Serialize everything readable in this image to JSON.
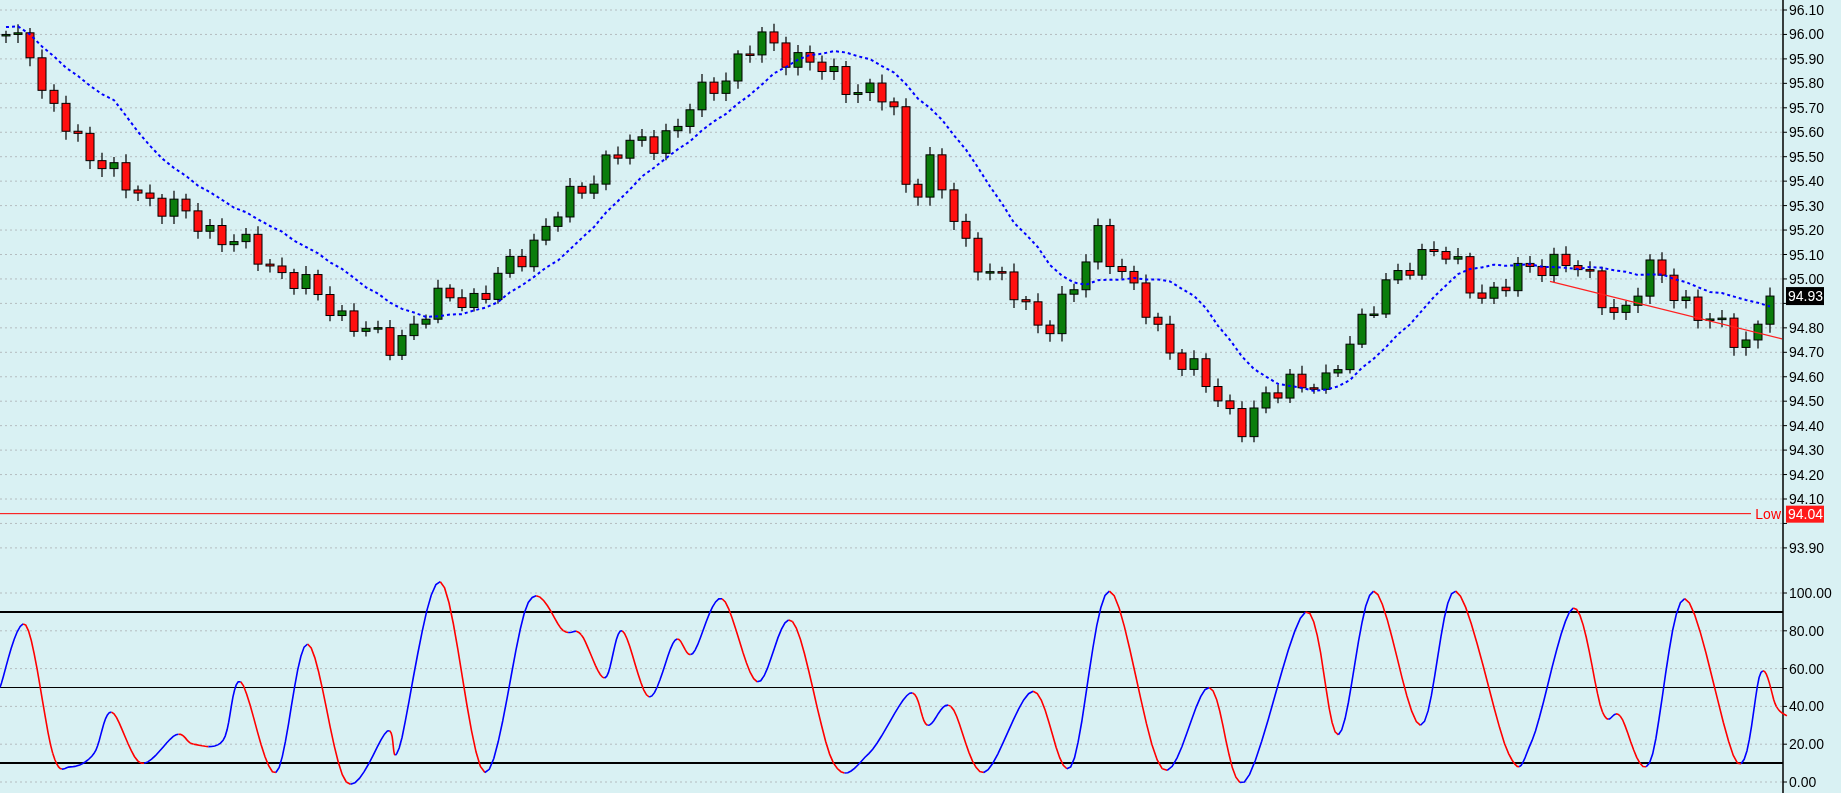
{
  "price_axis": {
    "upper_ticks": [
      "96.10",
      "96.00",
      "95.90",
      "95.80",
      "95.70",
      "95.60",
      "95.50",
      "95.40",
      "95.30",
      "95.20",
      "95.10",
      "95.00"
    ],
    "middle_ticks": [
      "94.80",
      "94.70",
      "94.60",
      "94.50",
      "94.40",
      "94.30",
      "94.20",
      "94.10"
    ],
    "lower_ticks": [
      "93.90"
    ]
  },
  "current_price": {
    "label": "94.93"
  },
  "low_line": {
    "label": "Low",
    "price": "94.04"
  },
  "oscillator_axis": {
    "ticks": [
      "100.00",
      "80.00",
      "60.00",
      "40.00",
      "20.00",
      "0.00"
    ]
  }
}
